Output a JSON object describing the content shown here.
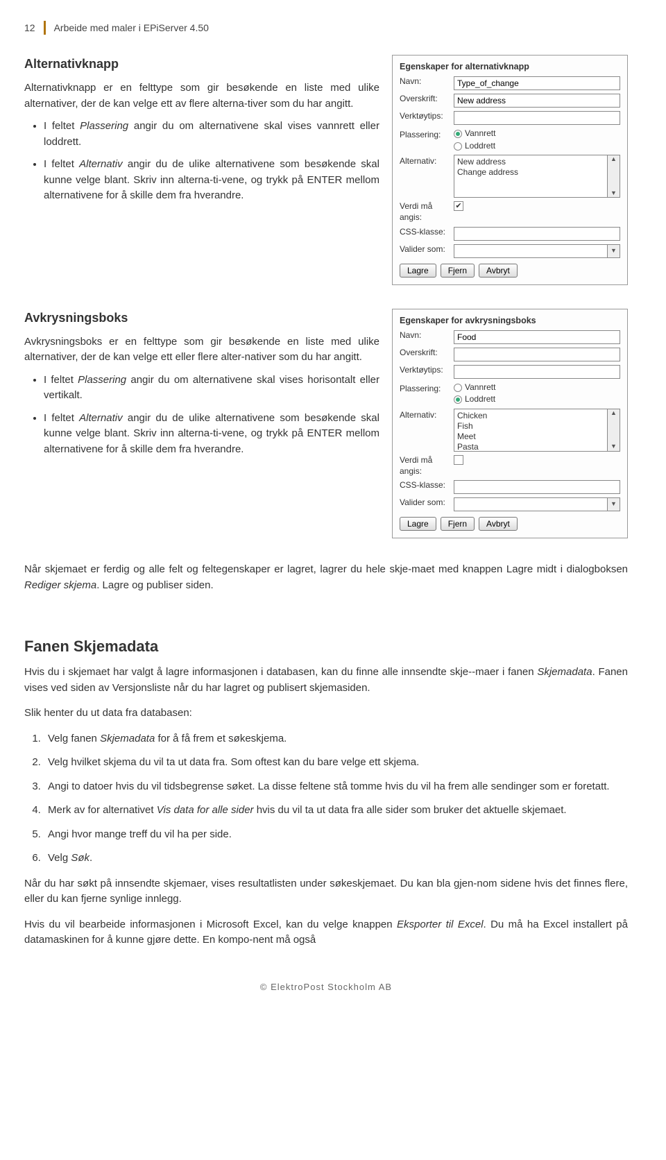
{
  "header": {
    "page_number": "12",
    "title": "Arbeide med maler i EPiServer 4.50"
  },
  "section1": {
    "heading": "Alternativknapp",
    "intro": "Alternativknapp er en felttype som gir besøkende en liste med ulike alternativer, der de kan velge ett av flere alterna-tiver som du har angitt.",
    "bullets": [
      "I feltet <em>Plassering</em> angir du om alternativene skal vises vannrett eller loddrett.",
      "I feltet <em>Alternativ</em> angir du de ulike alternativene som besøkende skal kunne velge blant. Skriv inn alterna-ti-vene, og trykk på ENTER mellom alternativene for å skille dem fra hverandre."
    ],
    "panel": {
      "title": "Egenskaper for alternativknapp",
      "labels": {
        "navn": "Navn:",
        "overskrift": "Overskrift:",
        "verktoytips": "Verktøytips:",
        "plassering": "Plassering:",
        "alternativ": "Alternativ:",
        "verdi": "Verdi må angis:",
        "css": "CSS-klasse:",
        "valider": "Valider som:"
      },
      "navn_value": "Type_of_change",
      "overskrift_value": "New address",
      "verktoytips_value": "",
      "radio_vannrett": "Vannrett",
      "radio_loddrett": "Loddrett",
      "radio_selected": "vannrett",
      "alternativ_options": [
        "New address",
        "Change address"
      ],
      "verdi_checked": true,
      "css_value": "",
      "valider_value": "",
      "buttons": {
        "lagre": "Lagre",
        "fjern": "Fjern",
        "avbryt": "Avbryt"
      }
    }
  },
  "section2": {
    "heading": "Avkrysningsboks",
    "intro": "Avkrysningsboks er en felttype som gir besøkende en liste med ulike alternativer, der de kan velge ett eller flere alter-nativer som du har angitt.",
    "bullets": [
      "I feltet <em>Plassering</em> angir du om alternativene skal vises horisontalt eller vertikalt.",
      "I feltet <em>Alternativ</em> angir du de ulike alternativene som besøkende skal kunne velge blant. Skriv inn alterna-ti-vene, og trykk på ENTER mellom alternativene for å skille dem fra hverandre."
    ],
    "panel": {
      "title": "Egenskaper for avkrysningsboks",
      "labels": {
        "navn": "Navn:",
        "overskrift": "Overskrift:",
        "verktoytips": "Verktøytips:",
        "plassering": "Plassering:",
        "alternativ": "Alternativ:",
        "verdi": "Verdi må angis:",
        "css": "CSS-klasse:",
        "valider": "Valider som:"
      },
      "navn_value": "Food",
      "overskrift_value": "",
      "verktoytips_value": "",
      "radio_vannrett": "Vannrett",
      "radio_loddrett": "Loddrett",
      "radio_selected": "loddrett",
      "alternativ_options": [
        "Chicken",
        "Fish",
        "Meet",
        "Pasta"
      ],
      "verdi_checked": false,
      "css_value": "",
      "valider_value": "",
      "buttons": {
        "lagre": "Lagre",
        "fjern": "Fjern",
        "avbryt": "Avbryt"
      }
    }
  },
  "after_para": "Når skjemaet er ferdig og alle felt og feltegenskaper er lagret, lagrer du hele skje-maet med knappen Lagre midt i dialogboksen <em>Rediger skjema</em>. Lagre og publiser siden.",
  "section3": {
    "heading": "Fanen Skjemadata",
    "para1": "Hvis du i skjemaet har valgt å lagre informasjonen i databasen, kan du finne alle innsendte skje--maer i fanen  <em>Skjemadata</em>. Fanen vises ved siden av Versjonsliste når du har lagret og publisert skjemasiden.",
    "para2": "Slik henter du ut data fra databasen:",
    "steps": [
      "Velg fanen <em>Skjemadata</em> for å få frem et søkeskjema.",
      "Velg hvilket skjema du vil ta ut data fra. Som oftest kan du bare velge ett skjema.",
      "Angi to datoer hvis du vil tidsbegrense søket. La disse feltene stå tomme hvis du vil ha frem alle sendinger som er foretatt.",
      "Merk av for alternativet <em>Vis data for alle sider</em> hvis du vil ta ut data fra alle sider som bruker det aktuelle skjemaet.",
      "Angi hvor mange treff du vil ha per side.",
      "Velg <em>Søk</em>."
    ],
    "para3": "Når du har søkt på innsendte skjemaer, vises resultatlisten under søkeskjemaet. Du kan bla gjen-nom sidene hvis det finnes flere, eller du kan fjerne synlige innlegg.",
    "para4": "Hvis du vil bearbeide informasjonen i Microsoft Excel, kan du velge knappen <em>Eksporter til Excel</em>. Du må ha Excel installert på datamaskinen for å kunne gjøre dette. En kompo-nent må også"
  },
  "footer": "© ElektroPost Stockholm AB"
}
